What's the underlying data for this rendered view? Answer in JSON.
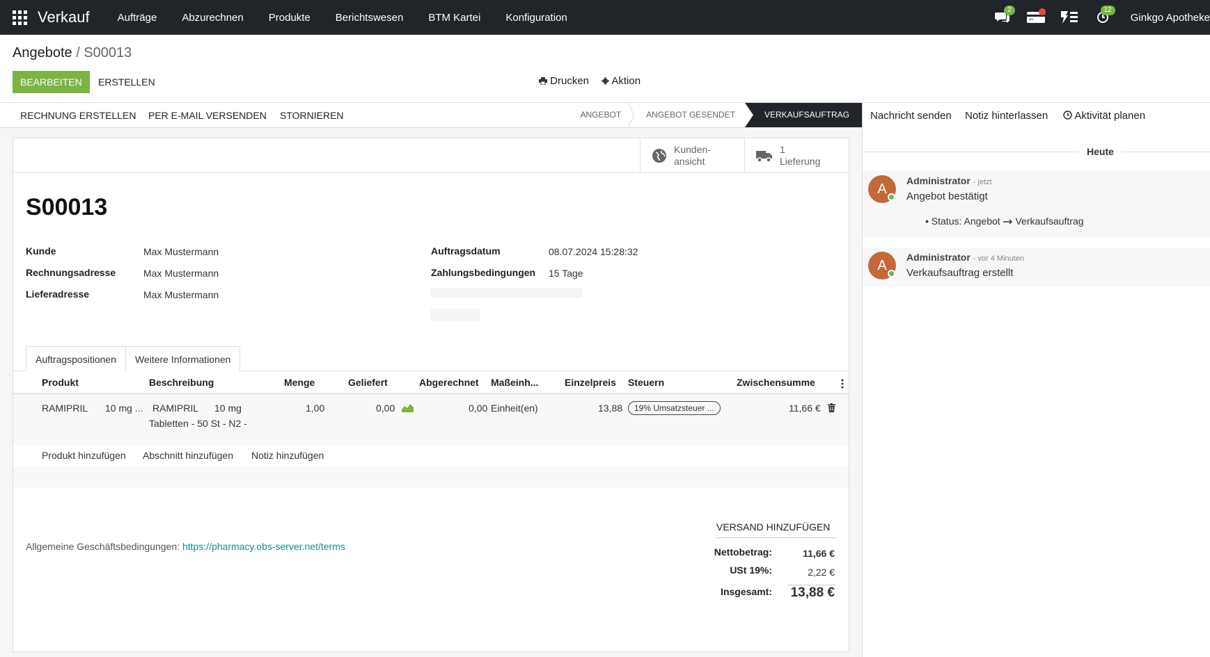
{
  "navbar": {
    "brand": "Verkauf",
    "menu": [
      "Aufträge",
      "Abzurechnen",
      "Produkte",
      "Berichtswesen",
      "BTM Kartei",
      "Konfiguration"
    ],
    "messages_count": "2",
    "activities_count": "12",
    "company": "Ginkgo Apotheke"
  },
  "breadcrumb": {
    "parent": "Angebote",
    "separator": " / ",
    "current": "S00013"
  },
  "control": {
    "edit": "BEARBEITEN",
    "create": "ERSTELLEN",
    "print": "Drucken",
    "action": "Aktion"
  },
  "statusbar": {
    "buttons": [
      "RECHNUNG ERSTELLEN",
      "PER E-MAIL VERSENDEN",
      "STORNIEREN"
    ],
    "stages": [
      "ANGEBOT",
      "ANGEBOT GESENDET",
      "VERKAUFSAUFTRAG"
    ],
    "active_stage": "VERKAUFSAUFTRAG"
  },
  "smart_buttons": {
    "customer_view": {
      "line1": "Kunden-",
      "line2": "ansicht"
    },
    "delivery": {
      "line1": "1",
      "line2": "Lieferung"
    }
  },
  "order": {
    "name": "S00013",
    "left_fields": [
      {
        "label": "Kunde",
        "value": "Max Mustermann"
      },
      {
        "label": "Rechnungsadresse",
        "value": "Max Mustermann"
      },
      {
        "label": "Lieferadresse",
        "value": "Max Mustermann"
      }
    ],
    "right_fields": [
      {
        "label": "Auftragsdatum",
        "value": "08.07.2024 15:28:32"
      },
      {
        "label": "Zahlungsbedingungen",
        "value": "15 Tage"
      }
    ]
  },
  "tabs": [
    "Auftragspositionen",
    "Weitere Informationen"
  ],
  "lines": {
    "headers": [
      "Produkt",
      "Beschreibung",
      "Menge",
      "Geliefert",
      "Abgerechnet",
      "Maßeinh...",
      "Einzelpreis",
      "Steuern",
      "Zwischensumme"
    ],
    "row": {
      "product": "RAMIPRIL",
      "product_strength": "10 mg ...",
      "desc_line1_a": "RAMIPRIL",
      "desc_line1_b": "10 mg",
      "desc_line2": "Tabletten - 50 St - N2 -",
      "qty": "1,00",
      "delivered": "0,00",
      "invoiced": "0,00",
      "uom": "Einheit(en)",
      "price": "13,88",
      "tax": "19% Umsatzsteuer ...",
      "subtotal": "11,66 €"
    },
    "add_links": [
      "Produkt hinzufügen",
      "Abschnitt hinzufügen",
      "Notiz hinzufügen"
    ]
  },
  "terms": {
    "label": "Allgemeine Geschäftsbedingungen: ",
    "link": "https://pharmacy.obs-server.net/terms"
  },
  "totals": {
    "shipping_button": "VERSAND HINZUFÜGEN",
    "net_label": "Nettobetrag:",
    "net_value": "11,66 €",
    "tax_label": "USt 19%:",
    "tax_value": "2,22 €",
    "total_label": "Insgesamt:",
    "total_value": "13,88 €"
  },
  "chatter": {
    "send_message": "Nachricht senden",
    "log_note": "Notiz hinterlassen",
    "schedule_activity": "Aktivität planen",
    "day": "Heute",
    "messages": [
      {
        "initial": "A",
        "author": "Administrator",
        "time": "- jetzt",
        "body": "Angebot bestätigt",
        "tracking_label": "Status:",
        "tracking_old": "Angebot",
        "tracking_new": "Verkaufsauftrag"
      },
      {
        "initial": "A",
        "author": "Administrator",
        "time": "- vor 4 Minuten",
        "body": "Verkaufsauftrag  erstellt"
      }
    ]
  },
  "colors": {
    "navbar": "#212529",
    "primary": "#7ab441",
    "link": "#1a8a8a",
    "avatar": "#c4683a"
  }
}
